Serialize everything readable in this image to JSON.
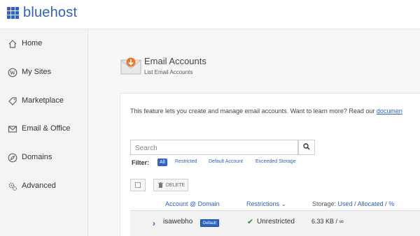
{
  "brand": {
    "name": "bluehost"
  },
  "sidebar": {
    "items": [
      {
        "label": "Home",
        "icon": "home-icon"
      },
      {
        "label": "My Sites",
        "icon": "wordpress-icon"
      },
      {
        "label": "Marketplace",
        "icon": "tag-icon"
      },
      {
        "label": "Email & Office",
        "icon": "mail-icon"
      },
      {
        "label": "Domains",
        "icon": "compass-icon"
      },
      {
        "label": "Advanced",
        "icon": "gears-icon"
      }
    ]
  },
  "page": {
    "title": "Email Accounts",
    "subtitle": "List Email Accounts",
    "info_text": "This feature lets you create and manage email accounts. Want to learn more? Read our ",
    "info_link": "documen"
  },
  "search": {
    "placeholder": "Search",
    "icon": "search-icon"
  },
  "filter": {
    "label": "Filter:",
    "active": "All",
    "options": [
      "Restricted",
      "Default Account",
      "Exceeded Storage"
    ]
  },
  "toolbar": {
    "delete_label": "DELETE",
    "delete_icon": "trash-icon"
  },
  "table": {
    "headers": {
      "account": "Account @ Domain",
      "restrictions": "Restrictions",
      "restrictions_arrow": "⌄",
      "storage_prefix": "Storage:",
      "storage_used": "Used",
      "storage_sep1": "/",
      "storage_allocated": "Allocated",
      "storage_sep2": "/",
      "storage_percent": "%"
    },
    "rows": [
      {
        "account": "isawebho",
        "badge": "Default",
        "restriction_icon": "check-icon",
        "restriction": "Unrestricted",
        "storage": "6.33 KB / ∞"
      }
    ]
  },
  "colors": {
    "accent": "#2f62c6",
    "success": "#3a8a3a",
    "envelope_orange": "#e8782a"
  }
}
